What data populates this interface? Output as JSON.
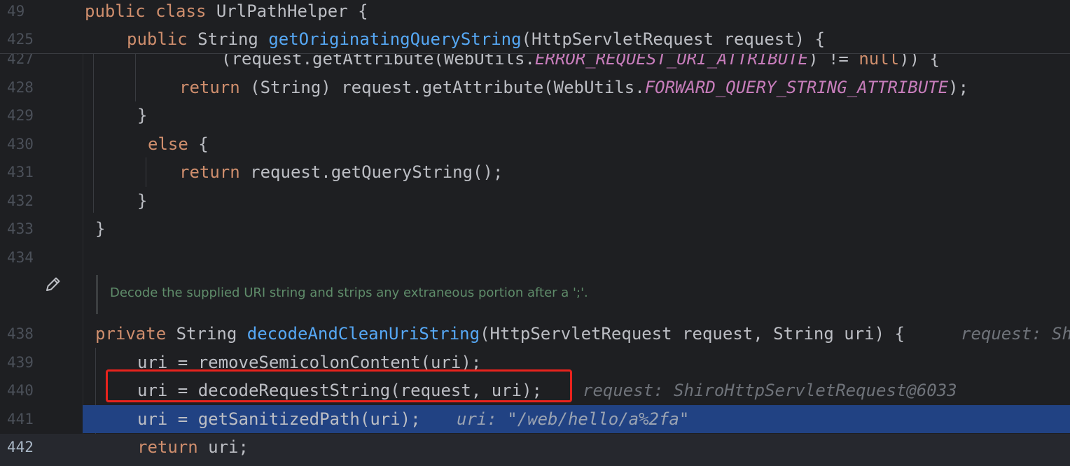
{
  "sticky": {
    "line1": {
      "num": "49",
      "kw": "public class ",
      "rest": "UrlPathHelper {"
    },
    "line2": {
      "num": "425",
      "kw": "public ",
      "type": "String ",
      "fn": "getOriginatingQueryString",
      "rest": "(HttpServletRequest request) {"
    }
  },
  "lines": [
    {
      "num": "427",
      "pre": "(request.getAttribute(WebUtils.",
      "const": "ERROR_REQUEST_URI_ATTRIBUTE",
      "mid": ") != ",
      "kw": "null",
      "post": ")) {"
    },
    {
      "num": "428",
      "kw": "return ",
      "pre": "(String) request.getAttribute(WebUtils.",
      "const": "FORWARD_QUERY_STRING_ATTRIBUTE",
      "post": ");"
    },
    {
      "num": "429",
      "text": "}"
    },
    {
      "num": "430",
      "kw": "else ",
      "text": "{"
    },
    {
      "num": "431",
      "kw": "return ",
      "text": "request.getQueryString();"
    },
    {
      "num": "432",
      "text": "}"
    },
    {
      "num": "433",
      "text": "}"
    },
    {
      "num": "434",
      "text": ""
    },
    {
      "num": "438",
      "kw": "private ",
      "type": "String ",
      "fn": "decodeAndCleanUriString",
      "rest": "(HttpServletRequest request, String uri) {",
      "hint": "request: Sh"
    },
    {
      "num": "439",
      "text": "uri = removeSemicolonContent(uri);"
    },
    {
      "num": "440",
      "text": "uri = decodeRequestString(request, uri);",
      "hint": "request: ShiroHttpServletRequest@6033"
    },
    {
      "num": "441",
      "text": "uri = getSanitizedPath(uri);",
      "hint": "uri: \"/web/hello/a%2fa\""
    },
    {
      "num": "442",
      "kw": "return ",
      "text": "uri;"
    }
  ],
  "doc_comment": "Decode the supplied URI string and strips any extraneous portion after a ';'.",
  "icons": {
    "edit": "pencil-icon"
  },
  "colors": {
    "background": "#1e1f22",
    "keyword": "#cf8e6d",
    "method": "#56a8f5",
    "constant": "#c77dbb",
    "execution_line": "#214283",
    "annotation_box": "#e8231d",
    "doc_comment": "#5f8c6a"
  }
}
